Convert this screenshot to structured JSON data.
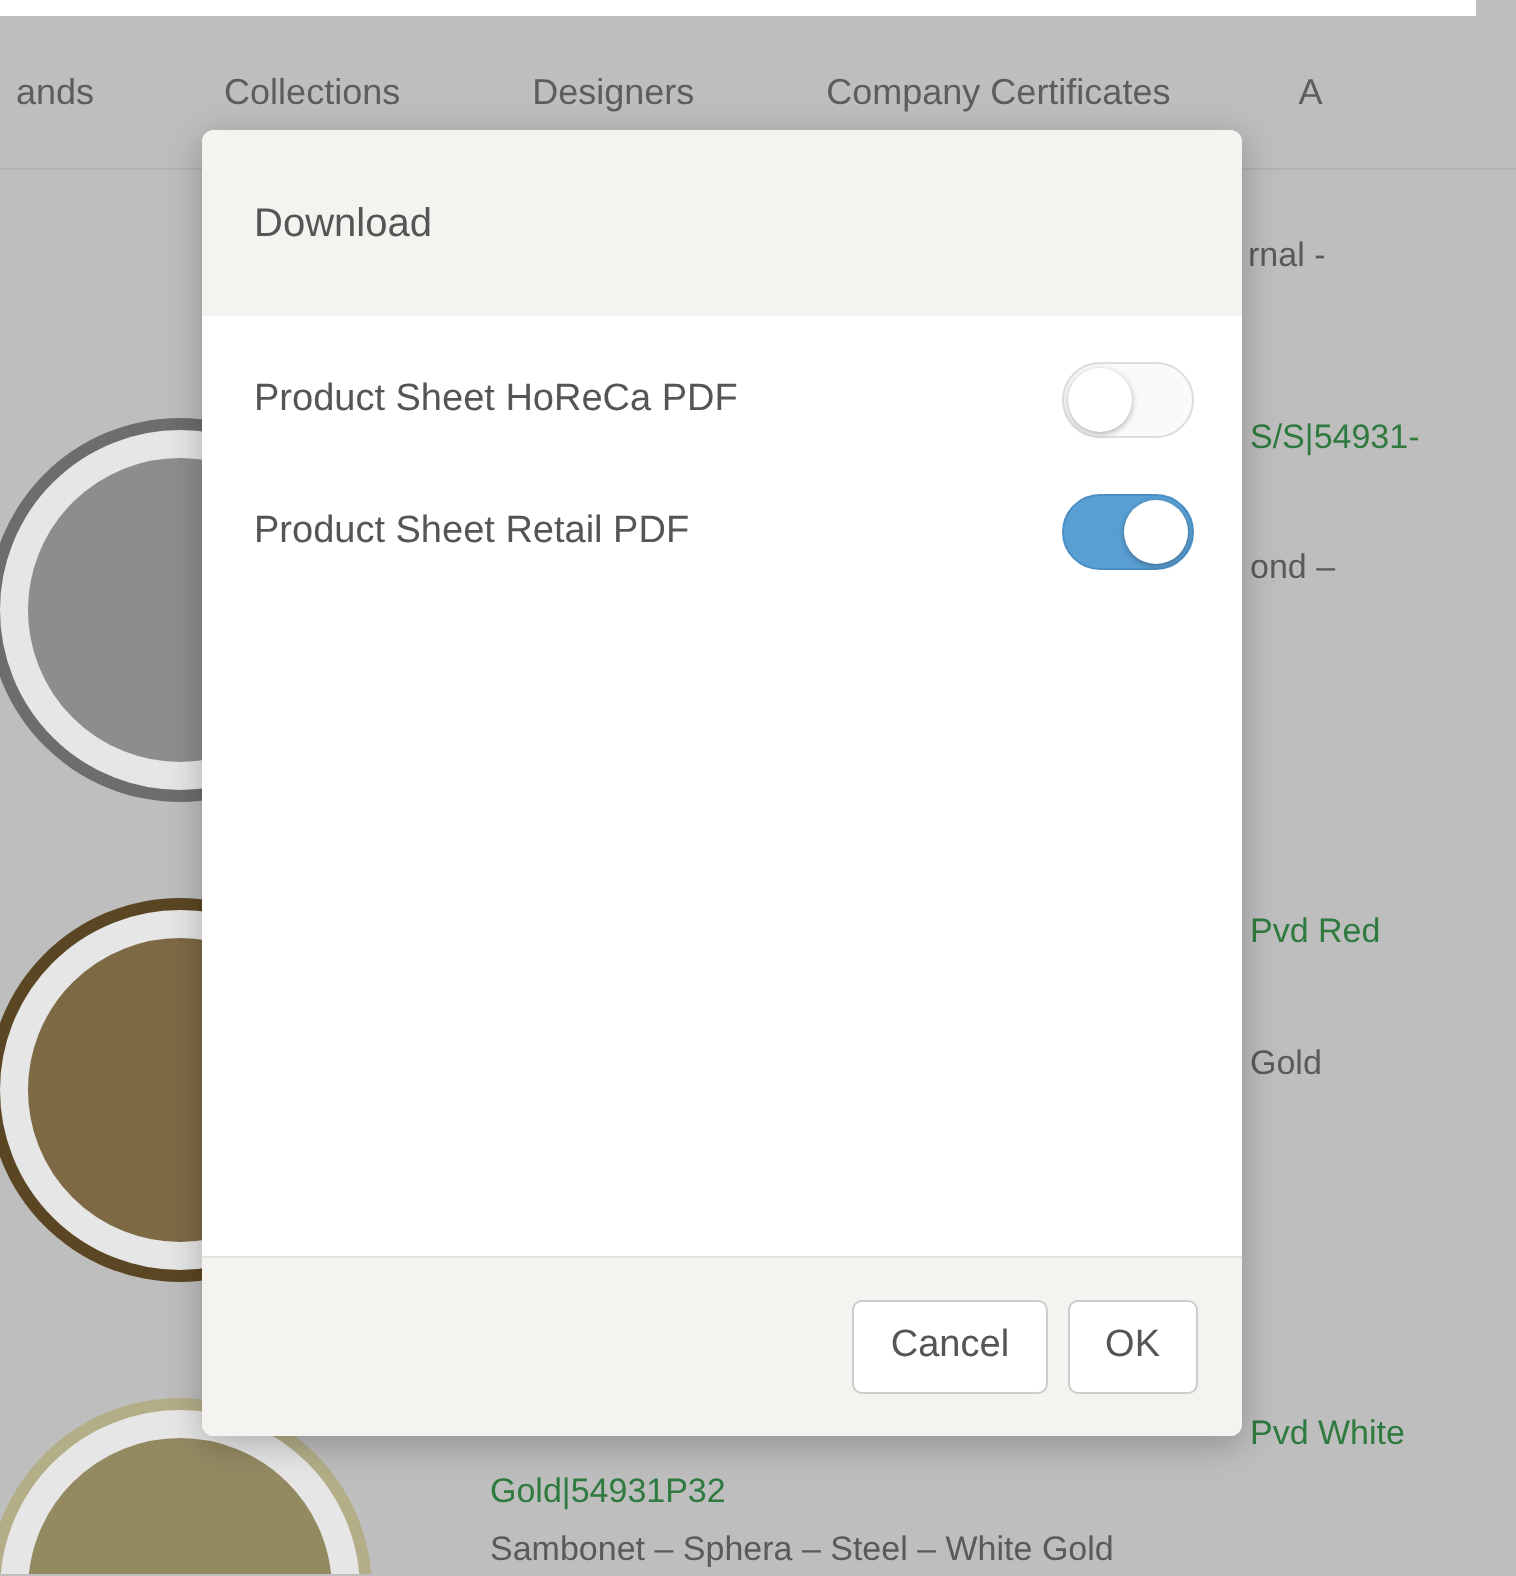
{
  "nav": {
    "items": [
      "ands",
      "Collections",
      "Designers",
      "Company Certificates",
      "A"
    ]
  },
  "listing": [
    {
      "text": "rnal -",
      "kind": "info"
    },
    {
      "text": "S/S|54931-",
      "kind": "link"
    },
    {
      "text": "ond –",
      "kind": "info"
    },
    {
      "text": "Pvd Red",
      "kind": "link"
    },
    {
      "text": "Gold",
      "kind": "info"
    },
    {
      "text": "Pvd White",
      "kind": "link"
    },
    {
      "text": "Gold|54931P32",
      "kind": "link"
    },
    {
      "text": "Sambonet – Sphera – Steel – White Gold",
      "kind": "info"
    }
  ],
  "modal": {
    "title": "Download",
    "options": [
      {
        "label": "Product Sheet HoReCa PDF",
        "on": false
      },
      {
        "label": "Product Sheet Retail PDF",
        "on": true
      }
    ],
    "buttons": [
      "Cancel",
      "OK"
    ]
  }
}
